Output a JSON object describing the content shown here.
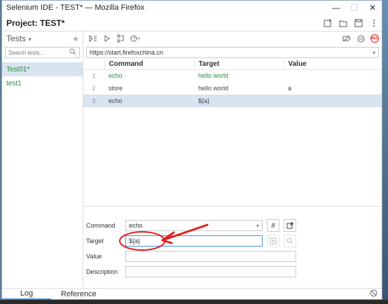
{
  "window": {
    "title": "Selenium IDE - TEST* — Mozilla Firefox",
    "minimize_glyph": "—",
    "maximize_glyph": "☐",
    "close_glyph": "✕"
  },
  "project": {
    "label": "Project:",
    "name": "TEST*"
  },
  "sidebar": {
    "dropdown_label": "Tests",
    "dropdown_caret": "▾",
    "add_glyph": "+",
    "search_placeholder": "Search tests...",
    "tests": [
      {
        "name": "Test01*",
        "selected": true
      },
      {
        "name": "test1",
        "selected": false
      }
    ]
  },
  "toolbar": {
    "rec_label": "REC"
  },
  "url": {
    "value": "https://start.firefoxchina.cn",
    "caret": "▾"
  },
  "table": {
    "headers": {
      "command": "Command",
      "target": "Target",
      "value": "Value"
    },
    "rows": [
      {
        "num": "1",
        "command": "echo",
        "target": "hello world",
        "value": "",
        "status": "ok"
      },
      {
        "num": "2",
        "command": "store",
        "target": "hello world",
        "value": "a",
        "status": "none"
      },
      {
        "num": "3",
        "command": "echo",
        "target": "${a}",
        "value": "",
        "status": "selected"
      }
    ]
  },
  "editor": {
    "command_label": "Command",
    "command_value": "echo",
    "command_caret": "▾",
    "comment_button": "//",
    "target_label": "Target",
    "target_value": "${a}",
    "value_label": "Value",
    "value_value": "",
    "description_label": "Description",
    "description_value": ""
  },
  "bottom_tabs": {
    "log": "Log",
    "reference": "Reference"
  },
  "colors": {
    "accent": "#4a90d9",
    "pass_green": "#2a8a3a",
    "selection": "#d8e4ef",
    "annotation_red": "#e02020"
  }
}
